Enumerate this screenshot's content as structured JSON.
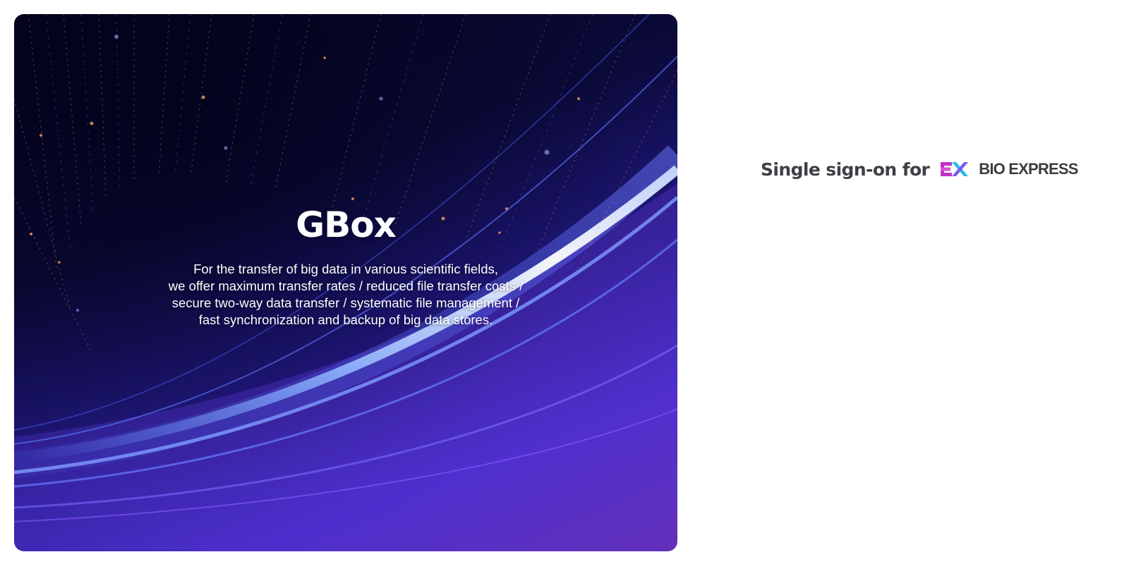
{
  "hero": {
    "title": "GBox",
    "description": [
      "For the transfer of big data in various scientific fields,",
      "we offer maximum transfer rates / reduced file transfer costs /",
      "secure two-way data transfer / systematic file management /",
      "fast synchronization and backup of big data stores."
    ]
  },
  "sso": {
    "label": "Single sign-on for",
    "provider_name": "BIO EXPRESS",
    "provider_logo_icon": "bio-express-bx-icon",
    "logo_colors": {
      "magenta": "#c030c8",
      "cyan": "#2bb8f0"
    }
  },
  "colors": {
    "hero_dark": "#05041f",
    "hero_blue": "#3a2ac8",
    "label_text": "#3f3f46"
  }
}
